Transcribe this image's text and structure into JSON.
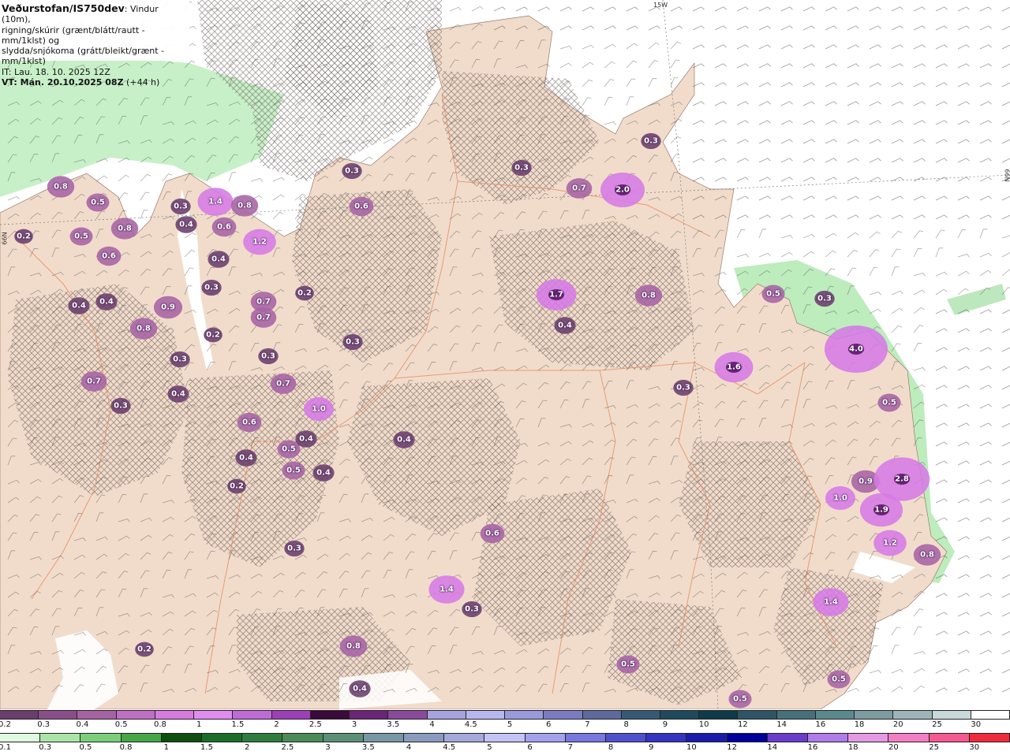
{
  "header": {
    "title": "Veðurstofan/IS750dev",
    "title_suffix": ": Vindur (10m),",
    "line2": "rigning/skúrir (grænt/blátt/rautt - mm/1klst) og",
    "line3": "slydda/snjókoma (grátt/bleikt/grænt - mm/1klst)",
    "it_line": "IT: Lau. 18. 10. 2025 12Z",
    "vt_prefix": "VT: Mán. 20.10.2025 08Z",
    "vt_suffix": " (+44 h)"
  },
  "grid_labels": {
    "lon": "15W",
    "lat_right": "66N",
    "lat_left": "66N"
  },
  "precip_labels": [
    "0.8",
    "0.5",
    "0.5",
    "0.8",
    "0.6",
    "0.4",
    "0.4",
    "0.9",
    "0.8",
    "0.3",
    "0.7",
    "0.3",
    "0.2",
    "0.3",
    "0.4",
    "1.4",
    "0.6",
    "0.4",
    "0.8",
    "1.2",
    "0.7",
    "0.7",
    "0.3",
    "0.2",
    "0.4",
    "0.2",
    "0.3",
    "0.7",
    "1.0",
    "0.6",
    "0.5",
    "0.4",
    "0.5",
    "0.4",
    "0.4",
    "0.2",
    "0.3",
    "0.6",
    "0.3",
    "1.4",
    "0.3",
    "0.8",
    "0.2",
    "0.6",
    "0.3",
    "0.3",
    "0.3",
    "0.7",
    "2.0",
    "1.7",
    "0.4",
    "0.8",
    "0.5",
    "0.3",
    "1.6",
    "0.3",
    "4.0",
    "0.5",
    "0.9",
    "2.8",
    "1.0",
    "1.9",
    "1.2",
    "0.8",
    "1.4",
    "0.5",
    "0.5",
    "0.4",
    "0.4",
    "0.5"
  ],
  "legend_precip": {
    "ticks": [
      "0.2",
      "0.3",
      "0.4",
      "0.5",
      "0.8",
      "1",
      "1.5",
      "2",
      "2.5",
      "3",
      "3.5",
      "4",
      "4.5",
      "5",
      "6",
      "7",
      "8",
      "9",
      "10",
      "12",
      "14",
      "16",
      "18",
      "20",
      "25",
      "30"
    ],
    "colors": [
      "#6a3d6c",
      "#8a4f8b",
      "#a663a4",
      "#c070c4",
      "#d97ae0",
      "#e28cf0",
      "#c06ad8",
      "#9d3fb8",
      "#3a0a3a",
      "#6b2477",
      "#8a4a9b",
      "#a7a3de",
      "#b7b7f0",
      "#9999dd",
      "#7b7bc4",
      "#5d6a9c",
      "#345a76",
      "#1f4a5d",
      "#0f3a4a",
      "#2d5566",
      "#46707c",
      "#5a8a8e",
      "#7d9ca2",
      "#9db5b8",
      "#c9d8da",
      "#ffffff"
    ]
  },
  "legend_snow": {
    "ticks": [
      "0.1",
      "0.3",
      "0.5",
      "0.8",
      "1",
      "1.5",
      "2",
      "2.5",
      "3",
      "3.5",
      "4",
      "4.5",
      "5",
      "6",
      "7",
      "8",
      "9",
      "10",
      "12",
      "14",
      "16",
      "18",
      "20",
      "25",
      "30"
    ],
    "colors": [
      "#dff8df",
      "#a9e5a6",
      "#7bcf7a",
      "#46a646",
      "#0e4e0e",
      "#1a6e2a",
      "#2e7d3e",
      "#4a8b58",
      "#5c8f78",
      "#7797a6",
      "#8a9bbd",
      "#a4a8db",
      "#c3c3f6",
      "#a2a2ec",
      "#7777dd",
      "#5050cc",
      "#3434c0",
      "#1c1cac",
      "#00009a",
      "#6a3cc9",
      "#b07ce8",
      "#e39ae3",
      "#f07fc6",
      "#f35a8f",
      "#ee2c3e"
    ]
  }
}
